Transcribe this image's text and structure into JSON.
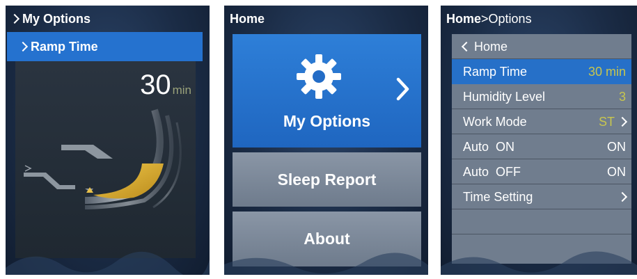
{
  "screen1": {
    "header": "My Options",
    "selected_item": "Ramp Time",
    "ramp_value": "30",
    "ramp_unit": "min"
  },
  "screen2": {
    "header": "Home",
    "buttons": [
      {
        "label": "My Options",
        "icon": "gear-icon"
      },
      {
        "label": "Sleep Report"
      },
      {
        "label": "About"
      }
    ]
  },
  "screen3": {
    "header_bold": "Home",
    "header_sep": ">",
    "header_rest": "Options",
    "back_label": "Home",
    "rows": [
      {
        "label": "Ramp Time",
        "value": "30 min"
      },
      {
        "label": "Humidity Level",
        "value": "3"
      },
      {
        "label": "Work Mode",
        "value": "ST"
      },
      {
        "label": "Auto  ON",
        "value": "ON"
      },
      {
        "label": "Auto  OFF",
        "value": "ON"
      },
      {
        "label": "Time Setting",
        "value": ""
      }
    ]
  },
  "colors": {
    "background": "#1b2c46",
    "selected": "#2572cf",
    "list_item": "#707d8e",
    "accent_value": "#c8c64e",
    "ramp_fill": "#e0b636"
  }
}
